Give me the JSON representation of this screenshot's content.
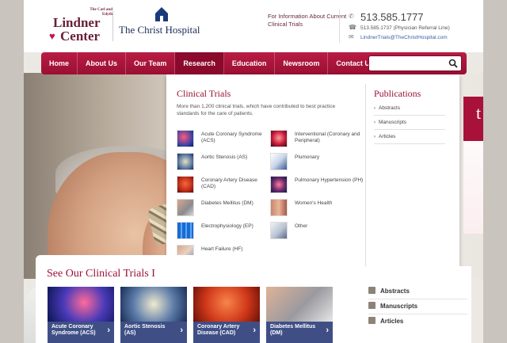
{
  "header": {
    "lindner_small": "The Carl and Edyth",
    "lindner_name": "Lindner",
    "lindner_center": "Center",
    "christ_name": "The Christ Hospital",
    "info_text": "For Information About Current Clinical Trials",
    "phone": "513.585.1777",
    "referral": "513.585.1737 (Physician Referral Line)",
    "email": "LindnerTrials@TheChristHospital.com"
  },
  "nav": {
    "items": [
      "Home",
      "About Us",
      "Our Team",
      "Research",
      "Education",
      "Newsroom",
      "Contact Us"
    ],
    "active": "Research",
    "search_placeholder": ""
  },
  "mega": {
    "title": "Clinical Trials",
    "description": "More than 1,200 clinical trials, which have contributed to best practice standards for the care of patients.",
    "left_trials": [
      "Acute Coronary Syndrome (ACS)",
      "Aortic Stenosis (AS)",
      "Coronary Artery Disease (CAD)",
      "Diabetes Mellitus (DM)",
      "Electrophysiology (EP)",
      "Heart Failure (HF)"
    ],
    "right_trials": [
      "Interventional (Coronary and Peripheral)",
      "Plumonary",
      "Pulmonary Hypertension (PH)",
      "Women's Health",
      "Other"
    ],
    "publications_title": "Publications",
    "publications": [
      "Abstracts",
      "Manuscripts",
      "Articles"
    ]
  },
  "bottom": {
    "title": "See Our Clinical Trials I",
    "cards": [
      "Acute Coronary Syndrome (ACS)",
      "Aortic Stenosis (AS)",
      "Coronary Artery Disease (CAD)",
      "Diabetes Mellitus (DM)"
    ]
  },
  "sidebar": {
    "items": [
      "Abstracts",
      "Manuscripts",
      "Articles"
    ],
    "hero_tab_letter": "t"
  }
}
